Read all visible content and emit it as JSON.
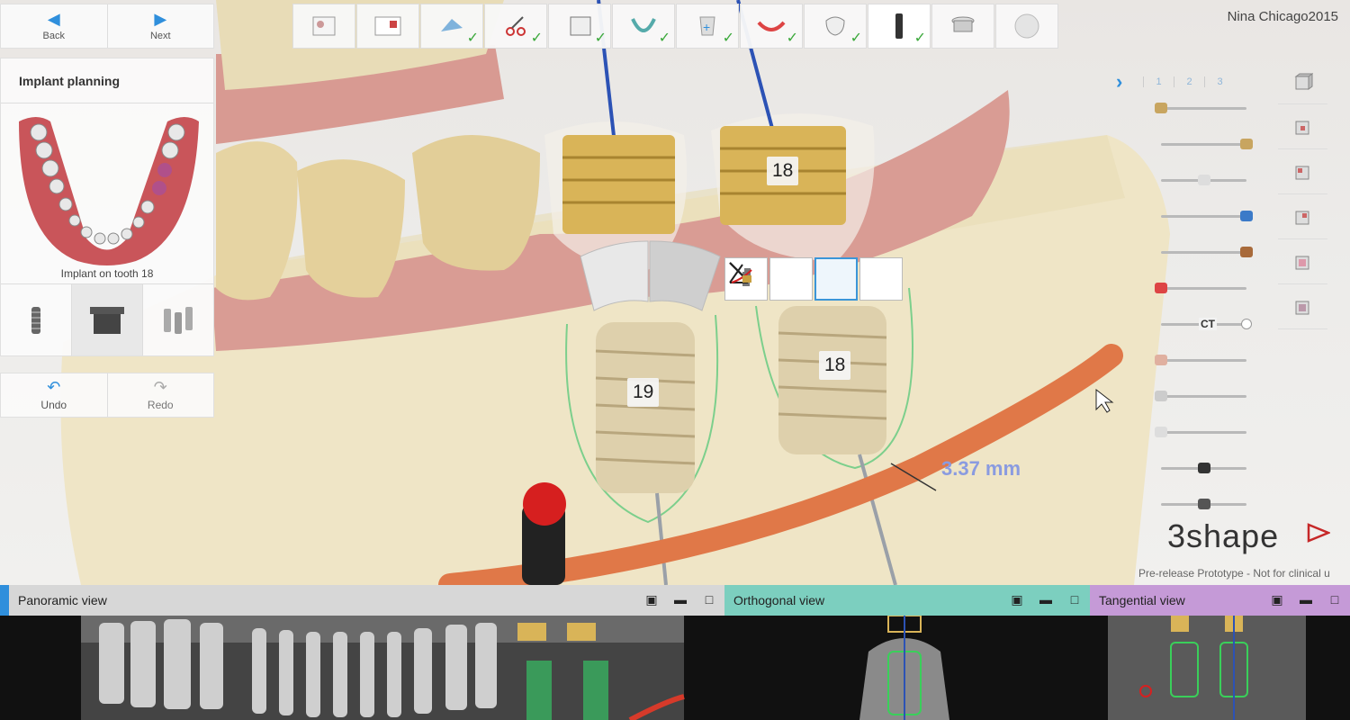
{
  "nav": {
    "back_label": "Back",
    "next_label": "Next"
  },
  "user": {
    "name": "Nina Chicago2015"
  },
  "workflow": {
    "steps": [
      {
        "icon": "patient-card-icon",
        "done": false
      },
      {
        "icon": "order-form-icon",
        "done": false
      },
      {
        "icon": "import-scan-icon",
        "done": true
      },
      {
        "icon": "segmentation-scissors-icon",
        "done": true
      },
      {
        "icon": "ct-slice-icon",
        "done": true
      },
      {
        "icon": "jaw-arch-icon",
        "done": true
      },
      {
        "icon": "add-tooth-icon",
        "done": true
      },
      {
        "icon": "gingiva-icon",
        "done": true
      },
      {
        "icon": "crown-icon",
        "done": true
      },
      {
        "icon": "implant-icon",
        "done": true,
        "current": true
      },
      {
        "icon": "sleeve-icon",
        "done": false
      },
      {
        "icon": "guide-disc-icon",
        "done": false
      }
    ]
  },
  "left_panel": {
    "title": "Implant planning",
    "caption": "Implant on tooth 18"
  },
  "history": {
    "undo_label": "Undo",
    "redo_label": "Redo"
  },
  "scene": {
    "labels": {
      "upper_18": "18",
      "lower_19": "19",
      "lower_18": "18"
    },
    "measurement": "3.37 mm"
  },
  "visibility": {
    "tabs": [
      "1",
      "2",
      "3"
    ],
    "ct_label": "CT",
    "slider_levels": [
      0.0,
      1.0,
      0.5,
      1.0,
      1.0,
      0.0,
      1.0,
      0.0,
      0.0,
      0.0,
      0.5,
      0.5
    ]
  },
  "brand": {
    "name": "3shape",
    "disclaimer": "Pre-release Prototype - Not for clinical u"
  },
  "views": {
    "panoramic": "Panoramic view",
    "orthogonal": "Orthogonal view",
    "tangential": "Tangential view"
  },
  "colors": {
    "accent": "#2f8fdc",
    "orthogonal_header": "#7ccfbf",
    "tangential_header": "#c59ad7",
    "panoramic_header": "#d7d7d7",
    "measurement": "#8a9be0"
  }
}
